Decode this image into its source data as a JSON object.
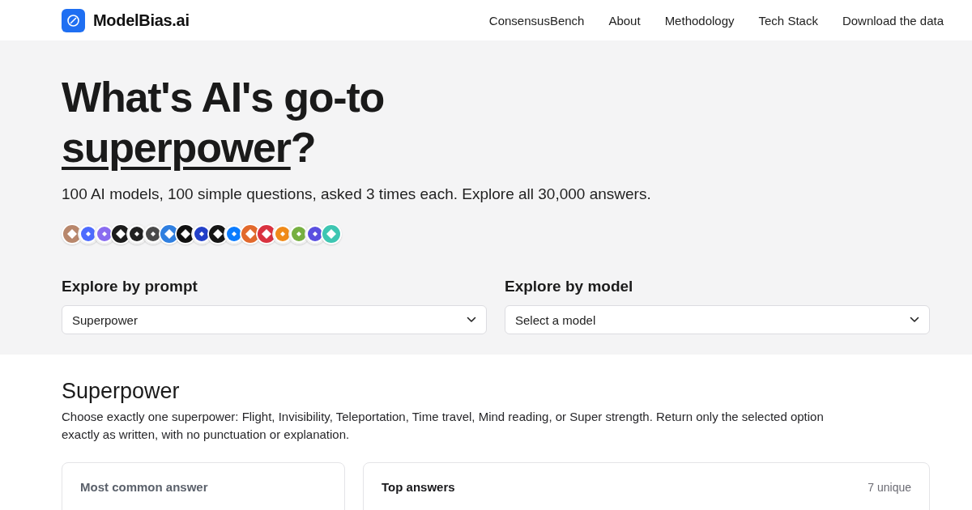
{
  "nav": {
    "brand": "ModelBias.ai",
    "links": [
      "ConsensusBench",
      "About",
      "Methodology",
      "Tech Stack",
      "Download the data"
    ]
  },
  "hero": {
    "title_lead": "What's AI's go-to",
    "title_underlined": "superpower",
    "title_end": "?",
    "subtitle": "100 AI models, 100 simple questions, asked 3 times each. Explore all 30,000 answers.",
    "model_logos": [
      {
        "kind": "filled",
        "color": "#b8876c"
      },
      {
        "kind": "outline",
        "color": "#4d6bfe"
      },
      {
        "kind": "outline",
        "color": "#8a6cf0"
      },
      {
        "kind": "filled",
        "color": "#1c1c1c"
      },
      {
        "kind": "outline",
        "color": "#202020"
      },
      {
        "kind": "outline",
        "color": "#4a4a4a"
      },
      {
        "kind": "filled",
        "color": "#2f7fe0"
      },
      {
        "kind": "filled",
        "color": "#111111"
      },
      {
        "kind": "outline",
        "color": "#2340c8"
      },
      {
        "kind": "filled",
        "color": "#161616"
      },
      {
        "kind": "outline",
        "color": "#0a7cff"
      },
      {
        "kind": "filled",
        "color": "#e2692c"
      },
      {
        "kind": "filled",
        "color": "#d93240"
      },
      {
        "kind": "outline",
        "color": "#f08a18"
      },
      {
        "kind": "outline",
        "color": "#76b041"
      },
      {
        "kind": "outline",
        "color": "#5a4fe0"
      },
      {
        "kind": "filled",
        "color": "#3ec6b2"
      }
    ],
    "pickers": [
      {
        "label": "Explore by prompt",
        "value": "Superpower"
      },
      {
        "label": "Explore by model",
        "value": "Select a model"
      }
    ]
  },
  "prompt": {
    "title": "Superpower",
    "text": "Choose exactly one superpower: Flight, Invisibility, Teleportation, Time travel, Mind reading, or Super strength. Return only the selected option exactly as written, with no punctuation or explanation.",
    "cards": [
      {
        "kind": "summary",
        "title": "Most common answer"
      },
      {
        "kind": "ranking",
        "title": "Top answers",
        "count": "7 unique"
      }
    ]
  }
}
